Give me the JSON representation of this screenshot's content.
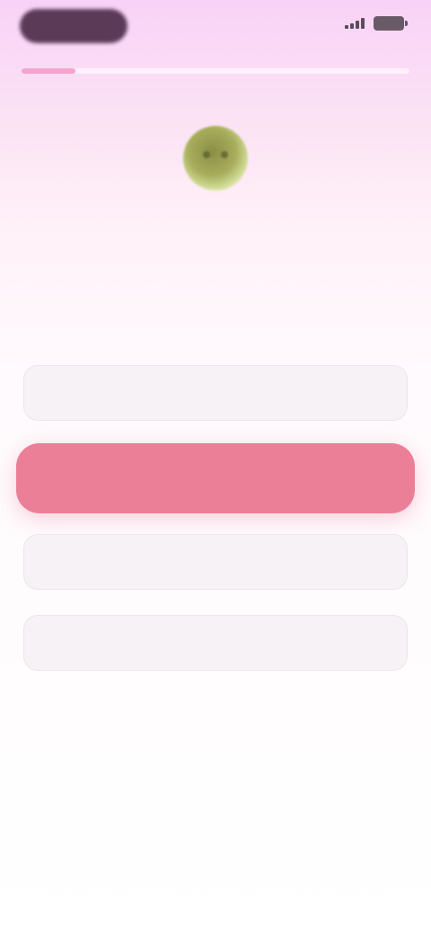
{
  "status_bar": {
    "center_text": "",
    "signal_icon": "signal-icon",
    "battery_icon": "battery-icon"
  },
  "progress": {
    "value": 0.14
  },
  "mascot": {
    "icon": "mascot-avatar"
  },
  "question": "",
  "options": [
    {
      "label": "",
      "selected": false
    },
    {
      "label": "",
      "selected": true
    },
    {
      "label": "",
      "selected": false
    },
    {
      "label": "",
      "selected": false
    }
  ],
  "colors": {
    "accent": "#ec7f98",
    "progress": "#f4a3cc",
    "background_top": "#f9d2f7"
  }
}
